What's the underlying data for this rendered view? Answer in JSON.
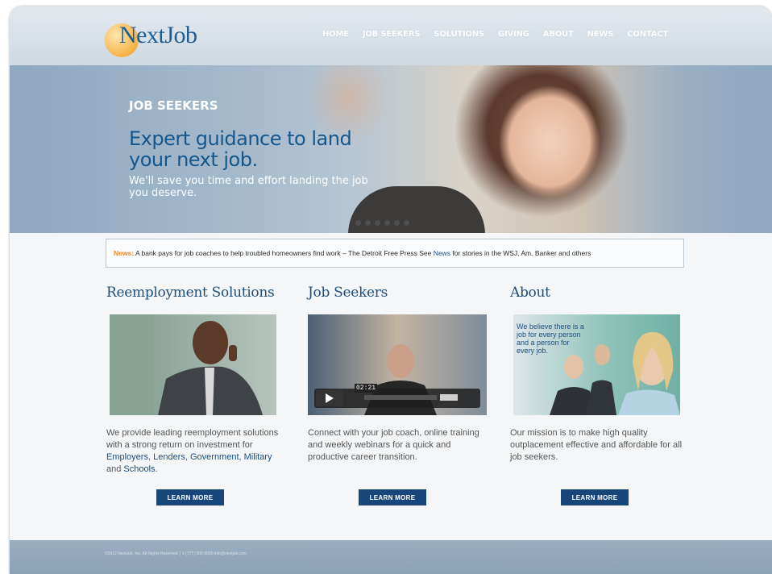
{
  "header": {
    "logo_text": "NextJob",
    "nav": [
      "HOME",
      "JOB SEEKERS",
      "SOLUTIONS",
      "GIVING",
      "ABOUT",
      "NEWS",
      "CONTACT"
    ]
  },
  "hero": {
    "section": "JOB SEEKERS",
    "headline": "Expert guidance to land your next job.",
    "subtext": "We'll save you time and effort landing the job you deserve."
  },
  "news": {
    "label": "News:",
    "text": " A bank pays for job coaches to help troubled homeowners find work – The Detroit Free Press See ",
    "link": "News",
    "tail": " for stories in the WSJ, Am. Banker and others"
  },
  "columns": [
    {
      "title": "Reemployment Solutions",
      "text_before": "We provide leading reemployment solutions with a strong return on investment for ",
      "links": [
        "Employers",
        "Lenders",
        "Government",
        "Military",
        "Schools"
      ],
      "button": "LEARN MORE"
    },
    {
      "title": "Job Seekers",
      "text": "Connect with your job coach, online training and weekly webinars for a quick and productive career transition.",
      "video_time": "02:21",
      "button": "LEARN MORE"
    },
    {
      "title": "About",
      "overlay": "We believe there is a job for every person and a person for every job.",
      "text": "Our mission is to make high quality outplacement effective and affordable for all job seekers.",
      "button": "LEARN MORE"
    }
  ],
  "footer": {
    "text": "©2012 NextJob, Inc. All Rights Reserved. | 1-(777) 000-0000 info@nextjob.com"
  },
  "colors": {
    "brand_blue": "#1d5d93",
    "button_navy": "#19467a",
    "news_orange": "#f0861e"
  }
}
